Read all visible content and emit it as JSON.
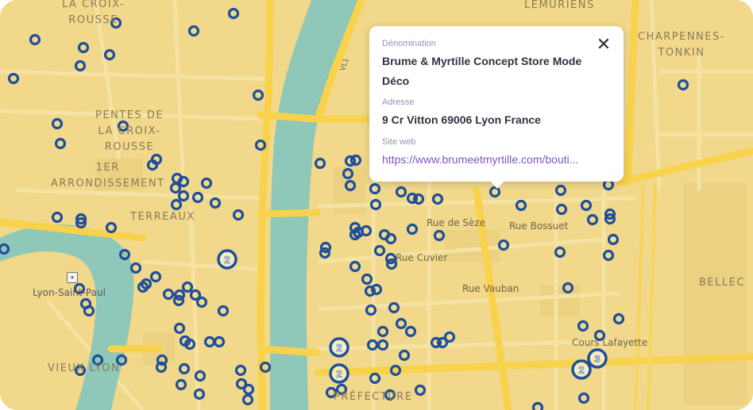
{
  "map": {
    "districts": [
      {
        "key": "croix_rousse",
        "lines": [
          "LA CROIX-",
          "ROUSSE"
        ]
      },
      {
        "key": "lemuriens",
        "lines": [
          "LÉMURIENS"
        ]
      },
      {
        "key": "charpennes",
        "lines": [
          "CHARPENNES-",
          "TONKIN"
        ]
      },
      {
        "key": "pentes",
        "lines": [
          "PENTES DE",
          "LA CROIX-",
          "ROUSSE"
        ]
      },
      {
        "key": "arr1",
        "lines": [
          "1ER",
          "ARRONDISSEMENT"
        ]
      },
      {
        "key": "terreaux",
        "lines": [
          "TERREAUX"
        ]
      },
      {
        "key": "belle",
        "lines": [
          "BELLEC"
        ]
      },
      {
        "key": "vieux_lyon",
        "lines": [
          "VIEUX LYON"
        ]
      },
      {
        "key": "prefecture",
        "lines": [
          "PRÉFECTURE"
        ]
      }
    ],
    "streets": {
      "rue_seze": "Rue de Sèze",
      "rue_bossuet": "Rue Bossuet",
      "rue_cuvier": "Rue Cuvier",
      "rue_vauban": "Rue Vauban",
      "cours_lafayette": "Cours Lafayette",
      "vl1": "VL1"
    },
    "poi": {
      "station": "Lyon-Saint-Paul",
      "station_icon": "metro-icon"
    },
    "colors": {
      "land": "#f1d88a",
      "water": "#8fc7b8",
      "major_road": "#f8d24a",
      "minor_road": "#f6e3a3",
      "marker": "#1d4f9c",
      "link": "#7c54c6"
    },
    "clusters": [
      {
        "key": "c1",
        "count": "2"
      },
      {
        "key": "c2",
        "count": "2"
      },
      {
        "key": "c3",
        "count": "2"
      },
      {
        "key": "c4",
        "count": "2"
      },
      {
        "key": "c5",
        "count": "3"
      }
    ]
  },
  "popup": {
    "name_label": "Dénomination",
    "name_value": "Brume & Myrtille Concept Store Mode Déco",
    "address_label": "Adresse",
    "address_value": "9 Cr Vitton 69006 Lyon France",
    "website_label": "Site web",
    "website_value": "https://www.brumeetmyrtille.com/bouti...",
    "close_icon": "close-icon"
  }
}
